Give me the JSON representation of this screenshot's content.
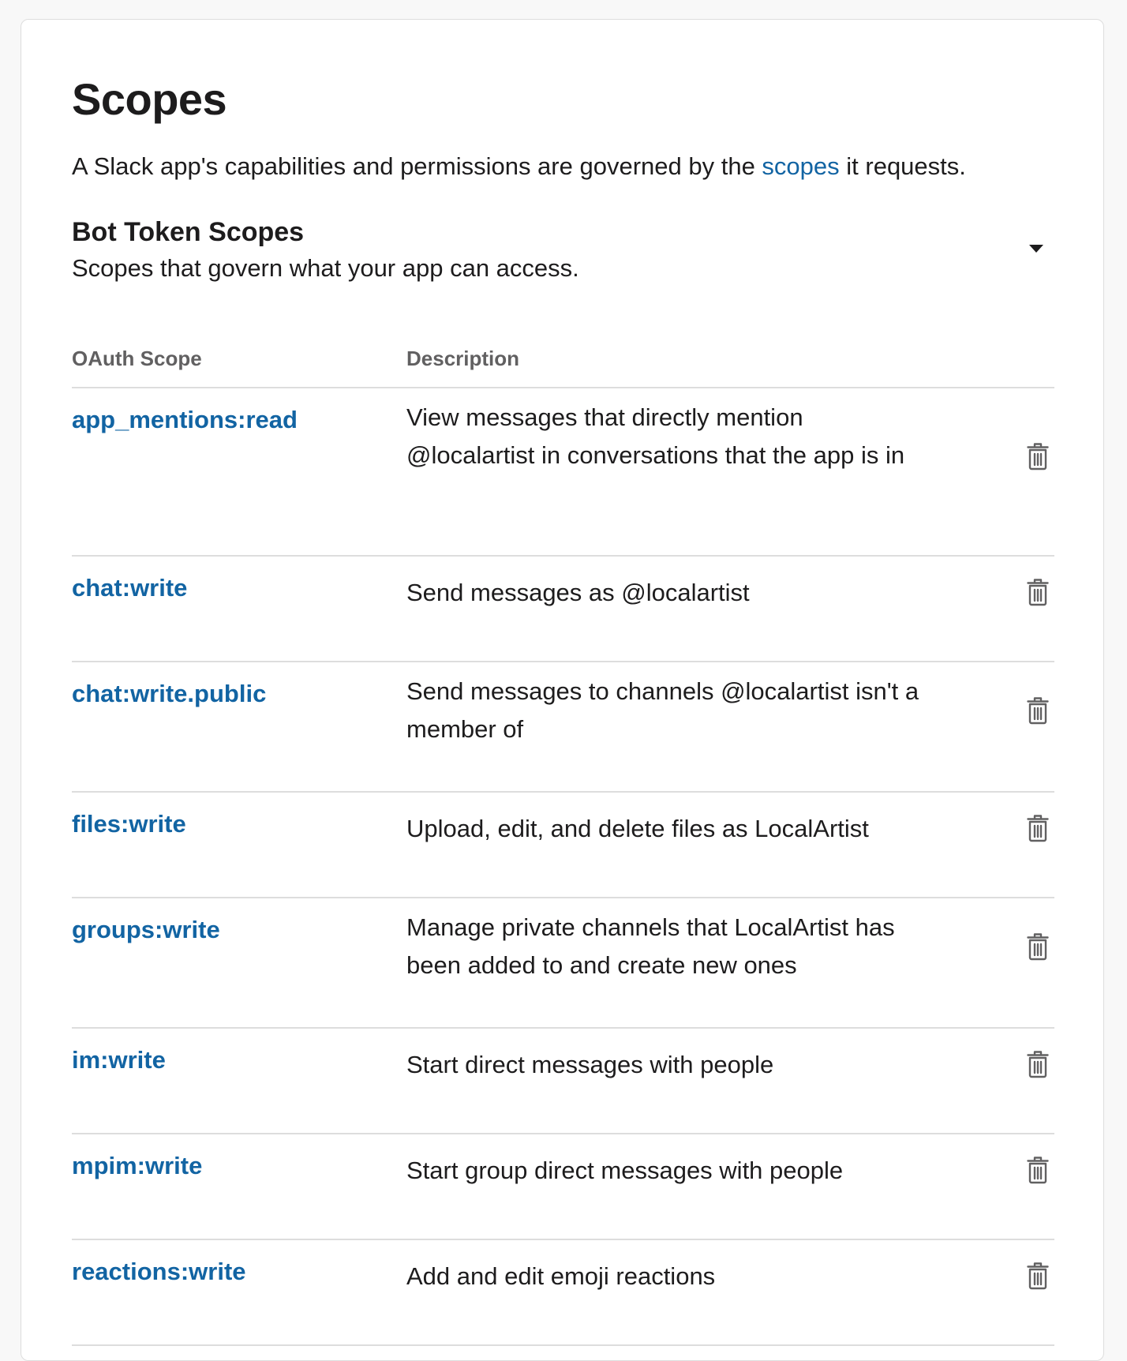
{
  "page": {
    "title": "Scopes",
    "intro_before": "A Slack app's capabilities and permissions are governed by the ",
    "intro_link": "scopes",
    "intro_after": " it requests."
  },
  "bot_section": {
    "title": "Bot Token Scopes",
    "subtitle": "Scopes that govern what your app can access.",
    "toggle_icon": "caret-down-icon"
  },
  "table": {
    "headers": {
      "scope": "OAuth Scope",
      "description": "Description"
    },
    "rows": [
      {
        "scope": "app_mentions:read",
        "description": "View messages that directly mention @localartist in conversations that the app is in"
      },
      {
        "scope": "chat:write",
        "description": "Send messages as @localartist"
      },
      {
        "scope": "chat:write.public",
        "description": "Send messages to channels @localartist isn't a member of"
      },
      {
        "scope": "files:write",
        "description": "Upload, edit, and delete files as LocalArtist"
      },
      {
        "scope": "groups:write",
        "description": "Manage private channels that LocalArtist has been added to and create new ones"
      },
      {
        "scope": "im:write",
        "description": "Start direct messages with people"
      },
      {
        "scope": "mpim:write",
        "description": "Start group direct messages with people"
      },
      {
        "scope": "reactions:write",
        "description": "Add and edit emoji reactions"
      }
    ],
    "row_action_icon": "trash-icon"
  },
  "colors": {
    "link": "#1264a3",
    "text": "#1d1c1d",
    "muted": "#616061",
    "divider": "#dddddd",
    "icon": "#616061"
  }
}
